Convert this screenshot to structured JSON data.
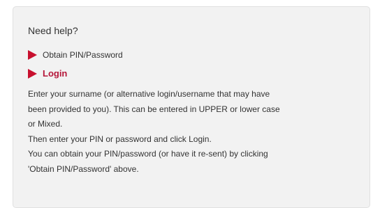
{
  "help": {
    "title": "Need help?",
    "links": {
      "obtain_pin": "Obtain PIN/Password",
      "login": "Login"
    },
    "instructions": {
      "line1": "Enter your surname (or alternative login/username that may have",
      "line2": "been provided to you). This can be entered in UPPER or lower case",
      "line3": "or Mixed.",
      "line4": "Then enter your PIN or password and click Login.",
      "line5": "You can obtain your PIN/password (or have it re-sent) by clicking",
      "line6": "'Obtain PIN/Password' above."
    }
  },
  "colors": {
    "accent": "#c8102e",
    "login_text": "#b5173a",
    "panel_bg": "#f2f2f2"
  },
  "icons": {
    "bullet": "play-triangle-icon"
  }
}
